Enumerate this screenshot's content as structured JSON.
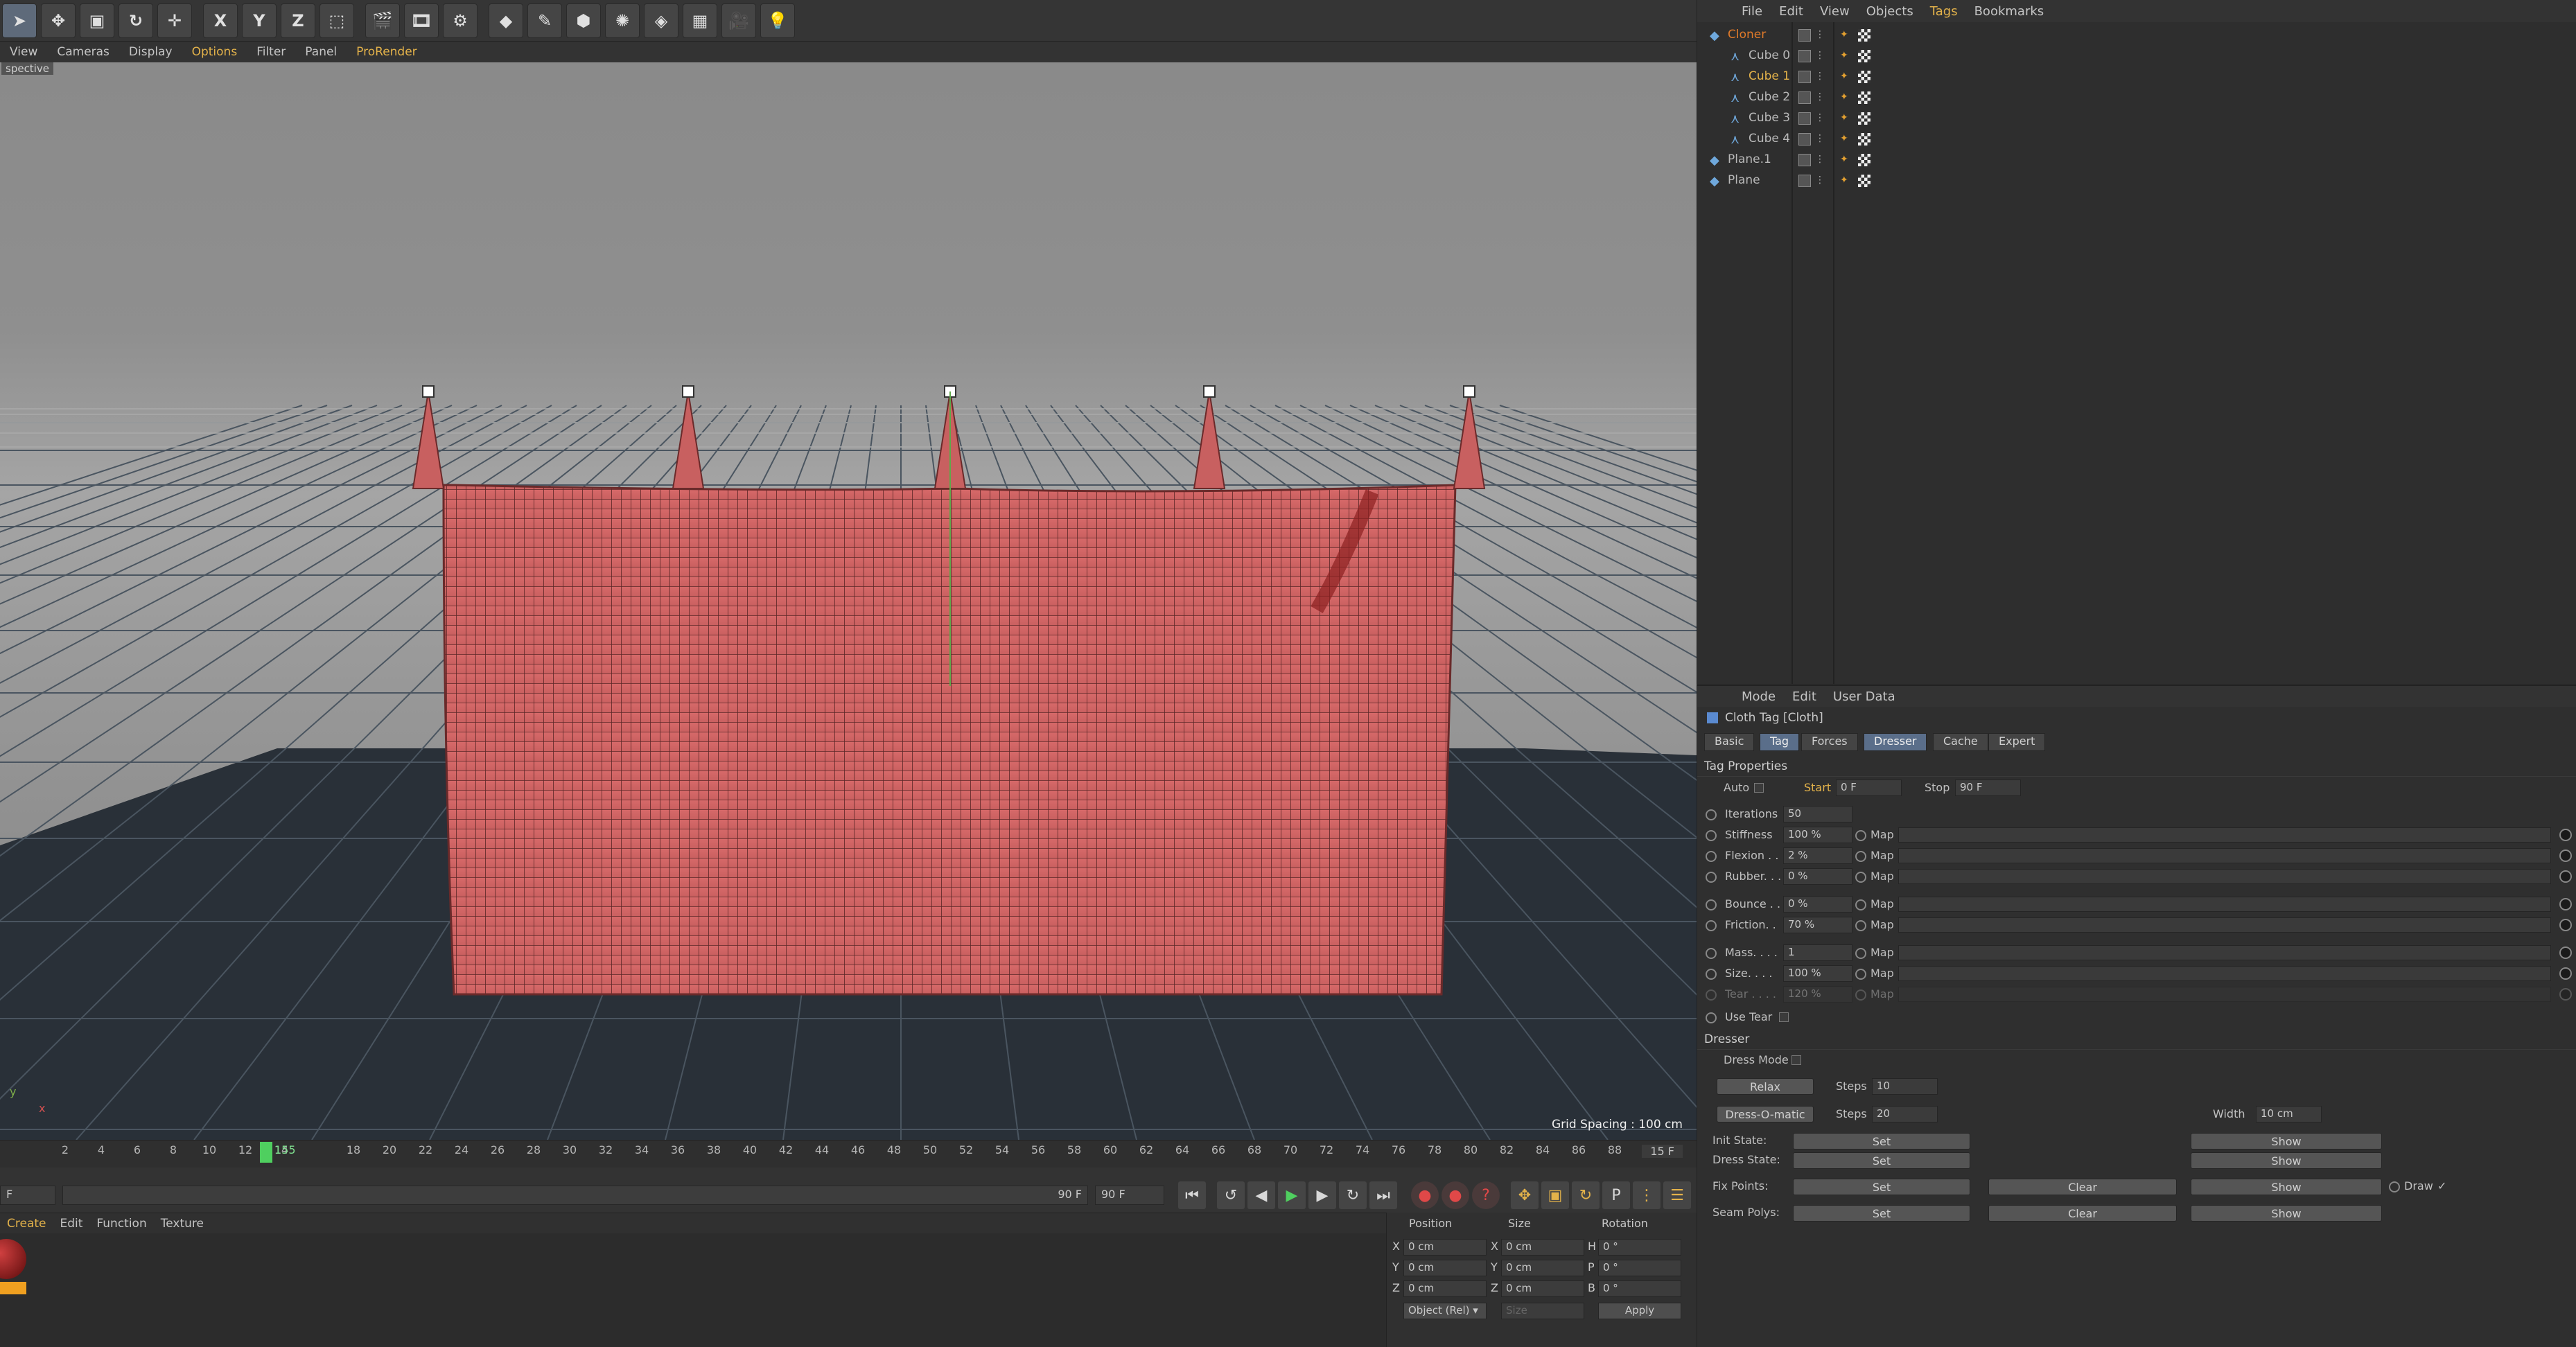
{
  "toolbar": {
    "tools": [
      {
        "icon": "arrow-select-icon",
        "glyph": "➤",
        "selected": true
      },
      {
        "icon": "move-icon",
        "glyph": "✥",
        "selected": false
      },
      {
        "icon": "scale-icon",
        "glyph": "▣",
        "selected": false
      },
      {
        "icon": "rotate-icon",
        "glyph": "↻",
        "selected": false
      },
      {
        "icon": "add-icon",
        "glyph": "✛",
        "selected": false
      },
      {
        "icon": "x-axis-icon",
        "glyph": "X",
        "selected": false
      },
      {
        "icon": "y-axis-icon",
        "glyph": "Y",
        "selected": false
      },
      {
        "icon": "z-axis-icon",
        "glyph": "Z",
        "selected": false
      },
      {
        "icon": "coordinate-system-icon",
        "glyph": "⬚",
        "selected": false
      },
      {
        "icon": "render-view-icon",
        "glyph": "🎬",
        "selected": false
      },
      {
        "icon": "render-picture-icon",
        "glyph": "🎞",
        "selected": false
      },
      {
        "icon": "render-settings-icon",
        "glyph": "⚙",
        "selected": false
      },
      {
        "icon": "cube-icon",
        "glyph": "◆",
        "selected": false
      },
      {
        "icon": "spline-pen-icon",
        "glyph": "✎",
        "selected": false
      },
      {
        "icon": "subdivision-icon",
        "glyph": "⬢",
        "selected": false
      },
      {
        "icon": "cloner-icon",
        "glyph": "✺",
        "selected": false
      },
      {
        "icon": "deformer-icon",
        "glyph": "◈",
        "selected": false
      },
      {
        "icon": "floor-icon",
        "glyph": "▦",
        "selected": false
      },
      {
        "icon": "camera-icon",
        "glyph": "🎥",
        "selected": false
      },
      {
        "icon": "light-icon",
        "glyph": "💡",
        "selected": false
      }
    ]
  },
  "viewport": {
    "menu": [
      "View",
      "Cameras",
      "Display",
      "Options",
      "Filter",
      "Panel",
      "ProRender"
    ],
    "menu_highlight": [
      "Options",
      "ProRender"
    ],
    "camera_label": "spective",
    "grid_spacing": "Grid Spacing : 100 cm",
    "axis_y": "y",
    "axis_x": "x"
  },
  "timeline": {
    "ticks": [
      "2",
      "4",
      "6",
      "8",
      "10",
      "12",
      "14",
      "18",
      "20",
      "22",
      "24",
      "26",
      "28",
      "30",
      "32",
      "34",
      "36",
      "38",
      "40",
      "42",
      "44",
      "46",
      "48",
      "50",
      "52",
      "54",
      "56",
      "58",
      "60",
      "62",
      "64",
      "66",
      "68",
      "70",
      "72",
      "74",
      "76",
      "78",
      "80",
      "82",
      "84",
      "86",
      "88",
      "90"
    ],
    "current": "155",
    "end_label": "15 F"
  },
  "transport": {
    "start_field": "F",
    "range_field": "90 F",
    "end_field": "90 F"
  },
  "material": {
    "menu": [
      "Create",
      "Edit",
      "Function",
      "Texture"
    ]
  },
  "coords": {
    "headers": [
      "Position",
      "Size",
      "Rotation"
    ],
    "rows": [
      {
        "axis": "X",
        "pos": "0 cm",
        "saxis": "X",
        "size": "0 cm",
        "raxis": "H",
        "rot": "0 °"
      },
      {
        "axis": "Y",
        "pos": "0 cm",
        "saxis": "Y",
        "size": "0 cm",
        "raxis": "P",
        "rot": "0 °"
      },
      {
        "axis": "Z",
        "pos": "0 cm",
        "saxis": "Z",
        "size": "0 cm",
        "raxis": "B",
        "rot": "0 °"
      }
    ],
    "mode": "Object (Rel) ▾",
    "size_mode": "Size",
    "apply": "Apply"
  },
  "objmgr": {
    "menu": [
      "File",
      "Edit",
      "View",
      "Objects",
      "Tags",
      "Bookmarks"
    ],
    "menu_highlight": "Tags",
    "objects": [
      {
        "name": "Cloner",
        "color": "#e07a2a",
        "indent": 0
      },
      {
        "name": "Cube 0",
        "color": "#b9b9b9",
        "indent": 1
      },
      {
        "name": "Cube 1",
        "color": "#e3b24a",
        "indent": 1
      },
      {
        "name": "Cube 2",
        "color": "#b9b9b9",
        "indent": 1
      },
      {
        "name": "Cube 3",
        "color": "#b9b9b9",
        "indent": 1
      },
      {
        "name": "Cube 4",
        "color": "#b9b9b9",
        "indent": 1
      },
      {
        "name": "Plane.1",
        "color": "#b9b9b9",
        "indent": 0
      },
      {
        "name": "Plane",
        "color": "#b9b9b9",
        "indent": 0
      }
    ]
  },
  "attr": {
    "menu": [
      "Mode",
      "Edit",
      "User Data"
    ],
    "title": "Cloth Tag [Cloth]",
    "tabs": [
      "Basic",
      "Tag",
      "Forces",
      "Dresser",
      "Cache",
      "Expert"
    ],
    "active_tabs": [
      "Tag",
      "Dresser"
    ],
    "tag_properties_title": "Tag Properties",
    "auto_label": "Auto",
    "start_label": "Start",
    "start_value": "0 F",
    "stop_label": "Stop",
    "stop_value": "90 F",
    "map_label": "Map",
    "params": [
      {
        "label": "Iterations",
        "value": "50",
        "map": false
      },
      {
        "label": "Stiffness",
        "value": "100 %",
        "map": true
      },
      {
        "label": "Flexion . .",
        "value": "2 %",
        "map": true
      },
      {
        "label": "Rubber. . .",
        "value": "0 %",
        "map": true
      },
      {
        "label": "Bounce . .",
        "value": "0 %",
        "map": true
      },
      {
        "label": "Friction. .",
        "value": "70 %",
        "map": true
      },
      {
        "label": "Mass. . . .",
        "value": "1",
        "map": true
      },
      {
        "label": "Size. . . .",
        "value": "100 %",
        "map": true
      },
      {
        "label": "Tear . . . .",
        "value": "120 %",
        "map": true
      }
    ],
    "use_tear": "Use Tear",
    "dresser_title": "Dresser",
    "dress_mode": "Dress Mode",
    "relax": "Relax",
    "steps_label": "Steps",
    "relax_steps": "10",
    "dress_o_matic": "Dress-O-matic",
    "dom_steps": "20",
    "width_label": "Width",
    "width_value": "10 cm",
    "init_state": "Init State:",
    "dress_state": "Dress State:",
    "fix_points": "Fix Points:",
    "seam_polys": "Seam Polys:",
    "set": "Set",
    "clear": "Clear",
    "show": "Show",
    "draw": "Draw",
    "draw_check": "✓"
  }
}
